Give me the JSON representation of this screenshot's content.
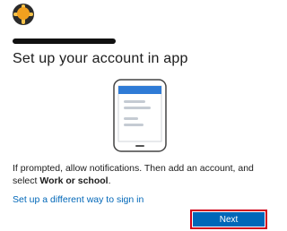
{
  "header": {
    "logo_icon": "org-logo-icon",
    "email_redacted": true
  },
  "main": {
    "title": "Set up your account in app",
    "description_part1": "If prompted, allow notifications. Then add an account, and select ",
    "description_bold": "Work or school",
    "description_part2": ".",
    "alt_link": "Set up a different way to sign in"
  },
  "actions": {
    "next_label": "Next"
  },
  "colors": {
    "accent": "#0067b8",
    "highlight_border": "#d0021b",
    "phone_screen_header": "#2f7bd6"
  }
}
